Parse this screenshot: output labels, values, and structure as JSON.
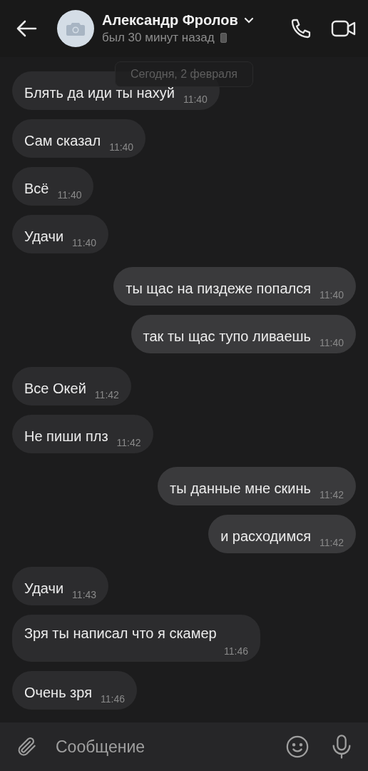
{
  "header": {
    "name": "Александр Фролов",
    "status": "был 30 минут назад"
  },
  "date_label": "Сегодня, 2 февраля",
  "messages": [
    {
      "text": "Блять да иди ты нахуй",
      "time": "11:40",
      "outgoing": false
    },
    {
      "text": "Сам сказал",
      "time": "11:40",
      "outgoing": false
    },
    {
      "text": "Всё",
      "time": "11:40",
      "outgoing": false
    },
    {
      "text": "Удачи",
      "time": "11:40",
      "outgoing": false
    },
    {
      "text": "ты щас на пиздеже попался",
      "time": "11:40",
      "outgoing": true
    },
    {
      "text": "так ты щас тупо ливаешь",
      "time": "11:40",
      "outgoing": true
    },
    {
      "text": "Все Окей",
      "time": "11:42",
      "outgoing": false
    },
    {
      "text": "Не пиши плз",
      "time": "11:42",
      "outgoing": false
    },
    {
      "text": "ты данные мне скинь",
      "time": "11:42",
      "outgoing": true
    },
    {
      "text": "и расходимся",
      "time": "11:42",
      "outgoing": true
    },
    {
      "text": "Удачи",
      "time": "11:43",
      "outgoing": false
    },
    {
      "text": "Зря ты написал что я скамер",
      "time": "11:46",
      "outgoing": false
    },
    {
      "text": "Очень зря",
      "time": "11:46",
      "outgoing": false
    }
  ],
  "composer": {
    "placeholder": "Сообщение"
  }
}
